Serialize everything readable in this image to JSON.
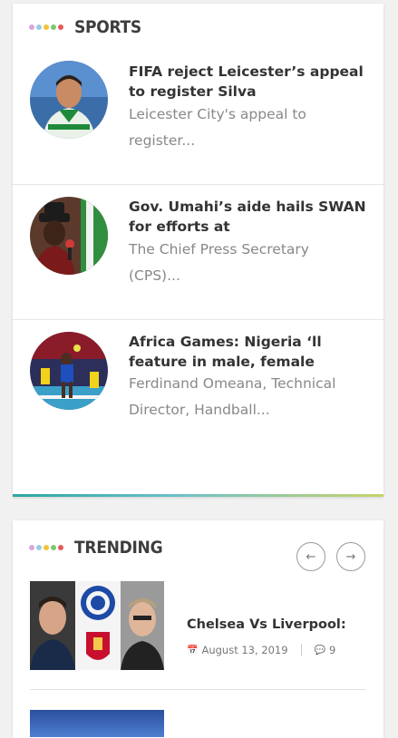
{
  "sports": {
    "title": "SPORTS",
    "dot_colors": [
      "#d7a6e0",
      "#9ecbe0",
      "#f0c23b",
      "#7bc96f",
      "#e85a5a"
    ],
    "items": [
      {
        "title": "FIFA reject Leicester’s appeal to register Silva",
        "excerpt": "Leicester City's appeal to register..."
      },
      {
        "title": "Gov. Umahi’s aide hails SWAN for efforts at",
        "excerpt": "The Chief Press Secretary (CPS)..."
      },
      {
        "title": "Africa Games: Nigeria ‘ll feature in male, female",
        "excerpt": "Ferdinand Omeana, Technical Director, Handball..."
      }
    ]
  },
  "trending": {
    "title": "TRENDING",
    "prev_icon": "arrow-left-icon",
    "next_icon": "arrow-right-icon",
    "prev_glyph": "←",
    "next_glyph": "→",
    "item": {
      "title": "Chelsea Vs Liverpool:",
      "date": "August 13, 2019",
      "comments": "9",
      "date_icon": "calendar-icon",
      "comment_icon": "comment-icon"
    }
  },
  "colors": {
    "accent_start": "#2aa7a1",
    "accent_end": "#c7d46a",
    "headline": "#333333",
    "excerpt": "#888888"
  }
}
